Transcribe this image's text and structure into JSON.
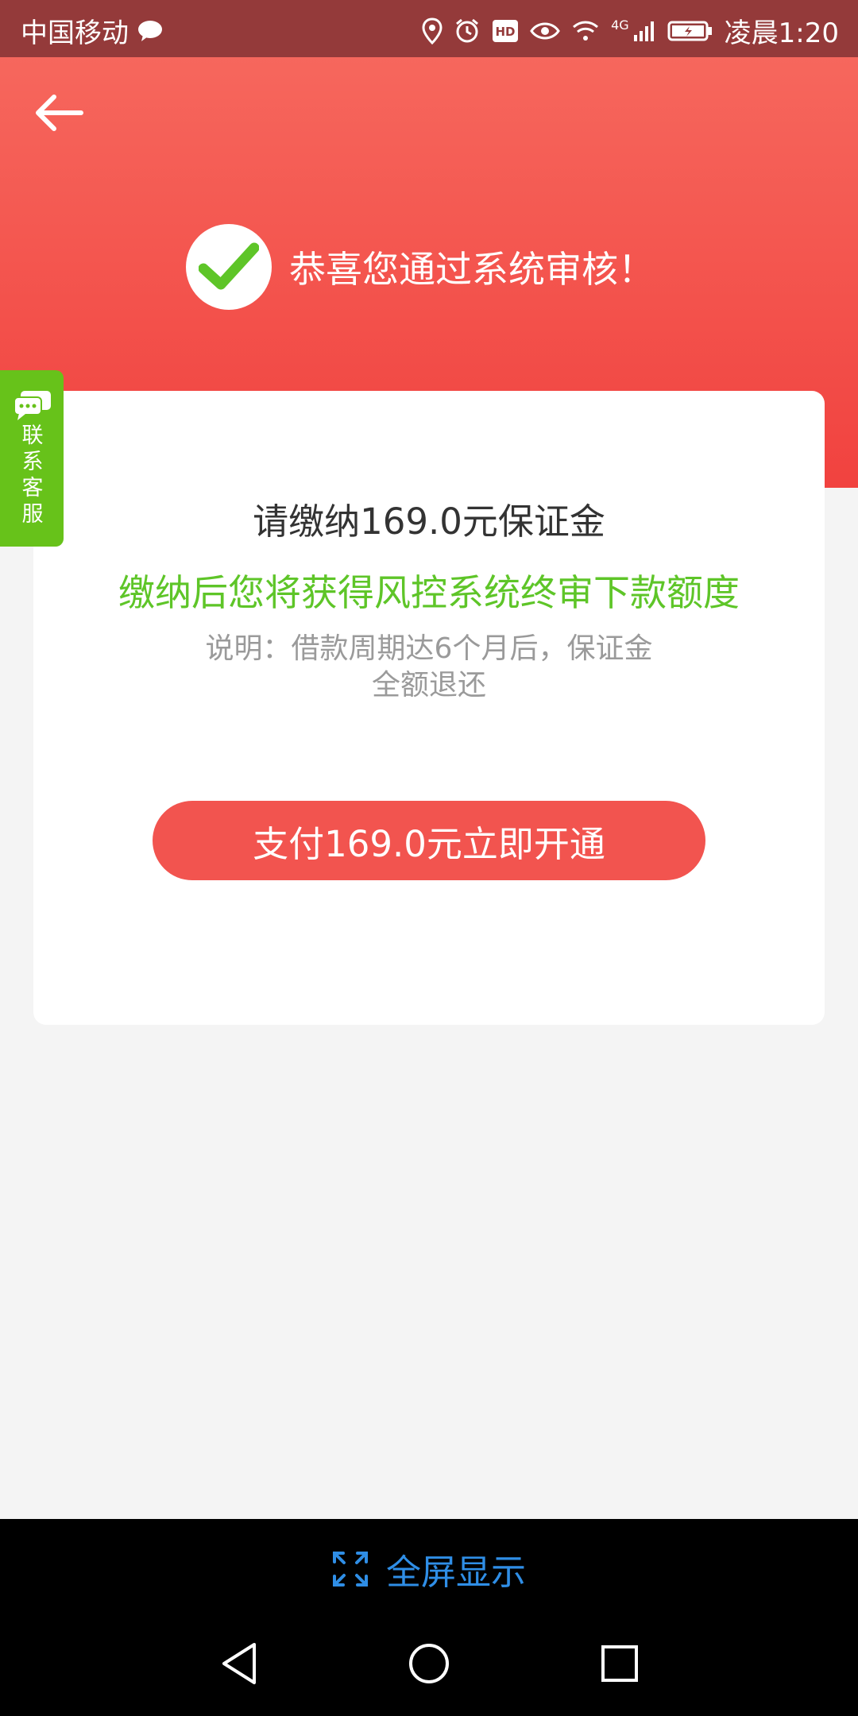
{
  "status_bar": {
    "carrier": "中国移动",
    "network": "4G",
    "time": "凌晨1:20",
    "icons": [
      "chat-bubble-icon",
      "location-icon",
      "alarm-icon",
      "hd-icon",
      "eye-icon",
      "wifi-icon",
      "signal-icon",
      "battery-icon"
    ]
  },
  "header": {
    "back_icon": "back-arrow-icon",
    "success_text": "恭喜您通过系统审核！"
  },
  "contact": {
    "label": "联系客服"
  },
  "card": {
    "deposit_text": "请缴纳169.0元保证金",
    "benefit_text": "缴纳后您将获得风控系统终审下款额度",
    "note_line1": "说明：借款周期达6个月后，保证金",
    "note_line2": "全额退还",
    "pay_button": "支付169.0元立即开通"
  },
  "bottom": {
    "fullscreen_label": "全屏显示"
  },
  "colors": {
    "status_bar": "#943a3a",
    "header_top": "#f6675d",
    "header_bottom": "#f1423f",
    "accent_green": "#5ec528",
    "button_red": "#f2544f",
    "fullscreen_blue": "#2f8ee6"
  }
}
